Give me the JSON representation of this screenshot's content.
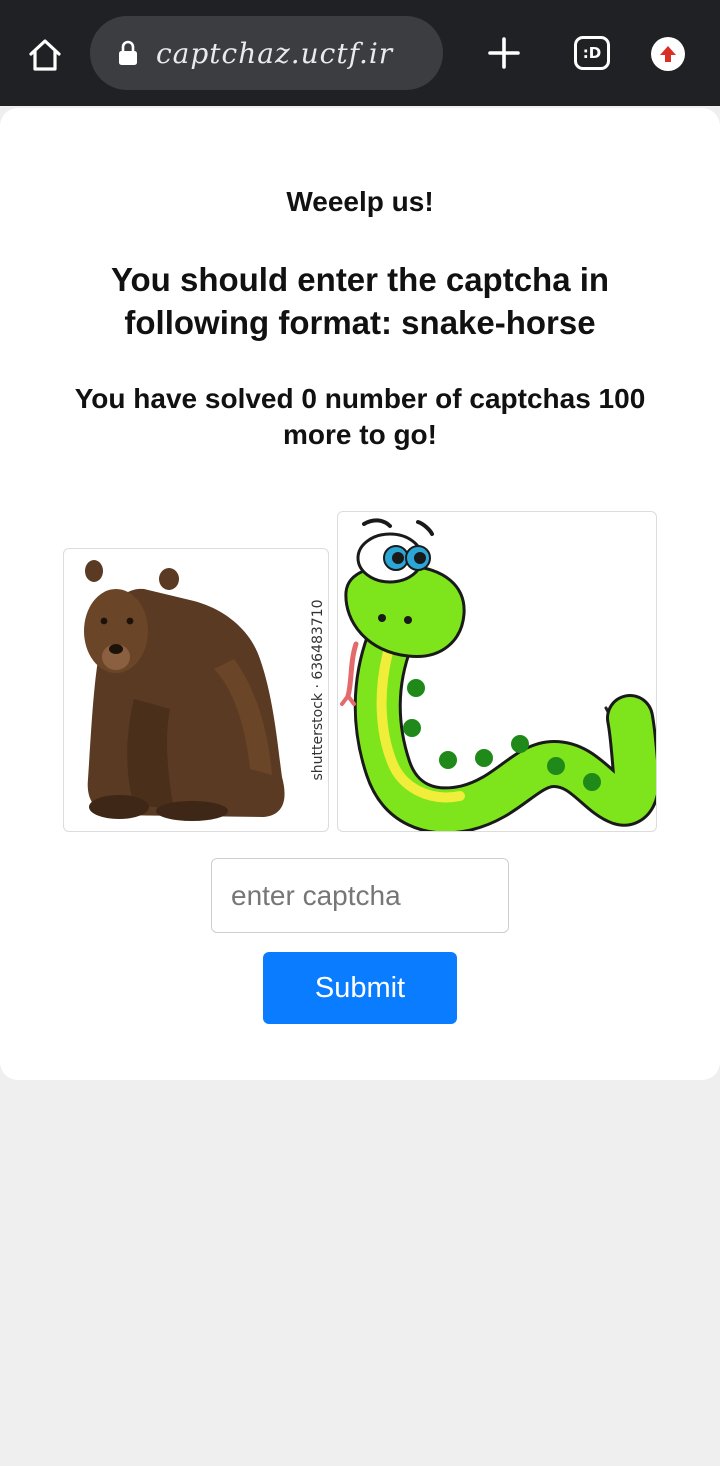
{
  "browser": {
    "url": "captchaz.uctf.ir",
    "tabs_icon_text": ":D",
    "accent": "#0a7cff"
  },
  "page": {
    "greeting": "Weeelp us!",
    "instructions": "You should enter the captcha in following format: snake-horse",
    "progress": "You have solved 0 number of captchas 100 more to go!",
    "watermark": "shutterstock · 636483710",
    "input_placeholder": "enter captcha",
    "submit_label": "Submit"
  }
}
